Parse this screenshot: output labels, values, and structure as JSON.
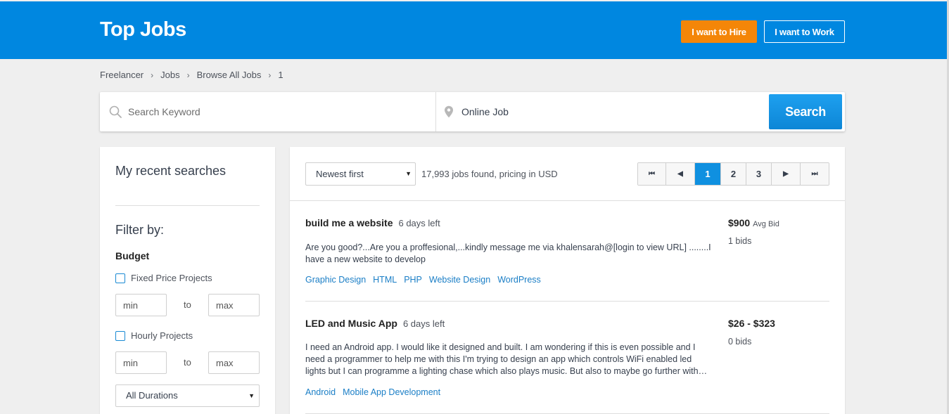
{
  "header": {
    "brand": "Top Jobs",
    "hire_label": "I want to Hire",
    "work_label": "I want to Work",
    "brand_color": "#0087e0",
    "hire_color": "#f48608"
  },
  "breadcrumb": [
    "Freelancer",
    "Jobs",
    "Browse All Jobs",
    "1"
  ],
  "breadcrumb_separator": "›",
  "search": {
    "keyword_placeholder": "Search Keyword",
    "location_value": "Online Job",
    "button_label": "Search",
    "keyword_icon": "search-icon",
    "location_icon": "map-pin-icon"
  },
  "sidebar": {
    "recent_title": "My recent searches",
    "filter_title": "Filter by:",
    "budget_title": "Budget",
    "fixed_label": "Fixed Price Projects",
    "hourly_label": "Hourly Projects",
    "min_placeholder": "min",
    "max_placeholder": "max",
    "to_label": "to",
    "duration_selected": "All Durations"
  },
  "results": {
    "sort_selected": "Newest first",
    "count_text": "17,993 jobs found, pricing in USD",
    "pagination": {
      "first": "⏮",
      "prev": "◀",
      "pages": [
        "1",
        "2",
        "3"
      ],
      "current": "1",
      "next": "▶",
      "last": "⏭"
    },
    "jobs": [
      {
        "title": "build me a website",
        "time_left": "6 days left",
        "description": "Are you good?...Are you a proffesional,...kindly message me via khalensarah@[login to view URL] ........I have a new website to develop",
        "tags": [
          "Graphic Design",
          "HTML",
          "PHP",
          "Website Design",
          "WordPress"
        ],
        "price": "$900",
        "price_note": "Avg Bid",
        "bids": "1 bids"
      },
      {
        "title": "LED and Music App",
        "time_left": "6 days left",
        "description": "I need an Android app. I would like it designed and built. I am wondering if this is even possible and I need a programmer to help me with this I'm trying to design an app which controls WiFi enabled led lights but I can programme a lighting chase which also plays music. But also to maybe go further with…",
        "tags": [
          "Android",
          "Mobile App Development"
        ],
        "price": "$26 - $323",
        "price_note": "",
        "bids": "0 bids"
      }
    ]
  }
}
